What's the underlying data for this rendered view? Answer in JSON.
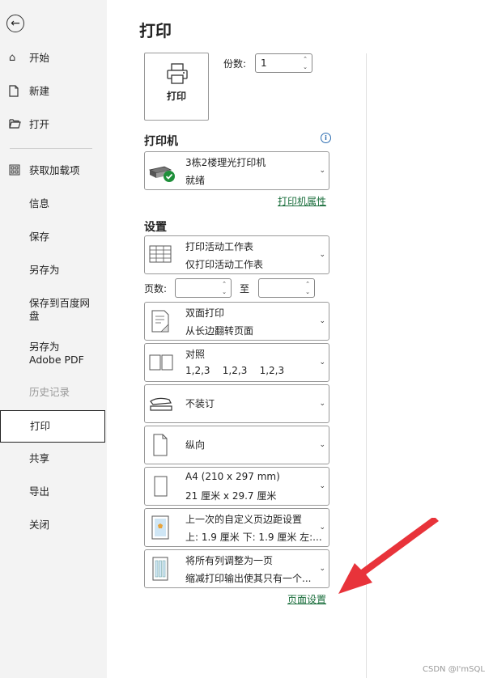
{
  "sidebar": {
    "items": [
      {
        "label": "开始",
        "icon": "home-icon"
      },
      {
        "label": "新建",
        "icon": "new-document-icon"
      },
      {
        "label": "打开",
        "icon": "folder-open-icon"
      },
      {
        "label": "获取加载项",
        "icon": "grid-icon"
      },
      {
        "label": "信息"
      },
      {
        "label": "保存"
      },
      {
        "label": "另存为"
      },
      {
        "label": "保存到百度网盘"
      },
      {
        "label": "另存为 Adobe PDF"
      },
      {
        "label": "历史记录",
        "disabled": true
      },
      {
        "label": "打印",
        "selected": true
      },
      {
        "label": "共享"
      },
      {
        "label": "导出"
      },
      {
        "label": "关闭"
      }
    ]
  },
  "main": {
    "title": "打印",
    "print_button": "打印",
    "copies_label": "份数:",
    "copies_value": "1",
    "printer_section": "打印机",
    "printer": {
      "name": "3栋2楼理光打印机",
      "status": "就绪"
    },
    "printer_properties": "打印机属性",
    "settings_section": "设置",
    "settings": [
      {
        "line1": "打印活动工作表",
        "line2": "仅打印活动工作表",
        "icon": "worksheet-icon"
      },
      {
        "line1": "双面打印",
        "line2": "从长边翻转页面",
        "icon": "duplex-icon"
      },
      {
        "line1": "对照",
        "line2": "1,2,3    1,2,3    1,2,3",
        "icon": "collate-icon"
      },
      {
        "line1": "不装订",
        "line2": "",
        "icon": "stapler-icon"
      },
      {
        "line1": "纵向",
        "line2": "",
        "icon": "portrait-icon"
      },
      {
        "line1": "A4 (210 x 297 mm)",
        "line2": "21 厘米 x 29.7 厘米",
        "icon": "paper-size-icon"
      },
      {
        "line1": "上一次的自定义页边距设置",
        "line2": "上: 1.9 厘米 下: 1.9 厘米 左:...",
        "icon": "margins-icon"
      },
      {
        "line1": "将所有列调整为一页",
        "line2": "缩减打印输出使其只有一个...",
        "icon": "scaling-icon"
      }
    ],
    "pages_label": "页数:",
    "to_label": "至",
    "page_setup": "页面设置"
  },
  "watermark": "CSDN @I'mSQL",
  "colors": {
    "link": "#1a6e3c",
    "arrow": "#e8333a",
    "sidebar_bg": "#f3f3f3"
  }
}
